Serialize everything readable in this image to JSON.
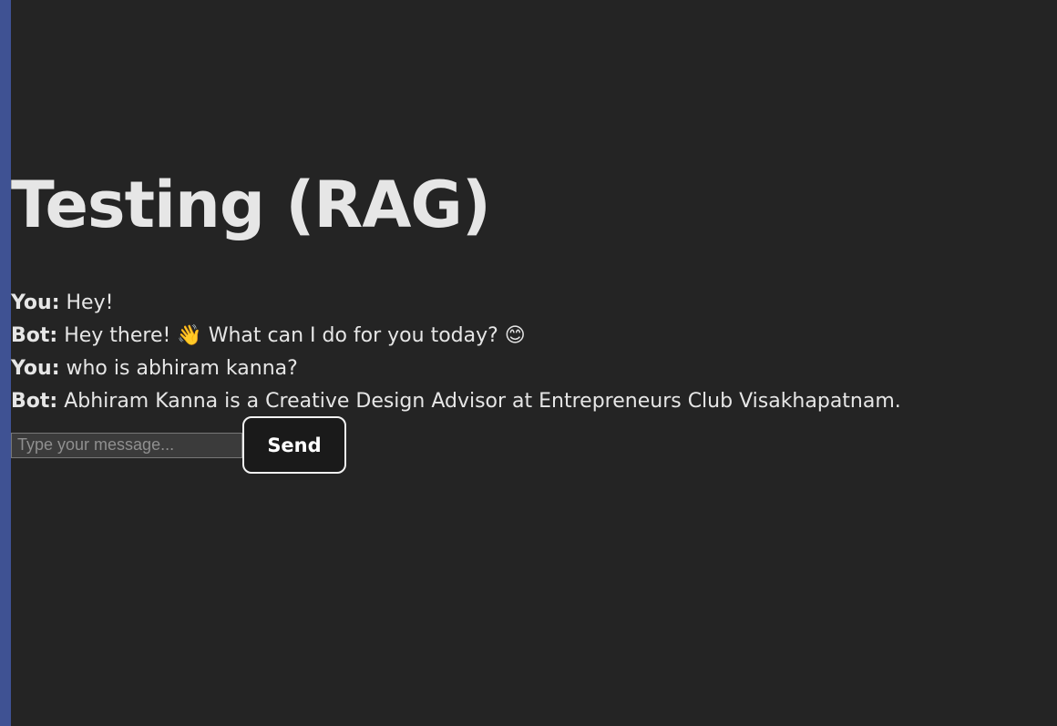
{
  "page": {
    "title": "Testing (RAG)"
  },
  "chat": {
    "messages": [
      {
        "speaker": "You:",
        "text": "Hey!"
      },
      {
        "speaker": "Bot:",
        "text": "Hey there! 👋 What can I do for you today? 😊"
      },
      {
        "speaker": "You:",
        "text": "who is abhiram kanna?"
      },
      {
        "speaker": "Bot:",
        "text": "Abhiram Kanna is a Creative Design Advisor at Entrepreneurs Club Visakhapatnam."
      }
    ]
  },
  "composer": {
    "placeholder": "Type your message...",
    "value": "",
    "send_label": "Send"
  },
  "colors": {
    "background": "#242424",
    "left_edge": "#3f5293",
    "button_bg": "#1a1a1a",
    "button_border": "#f2f2f2"
  }
}
